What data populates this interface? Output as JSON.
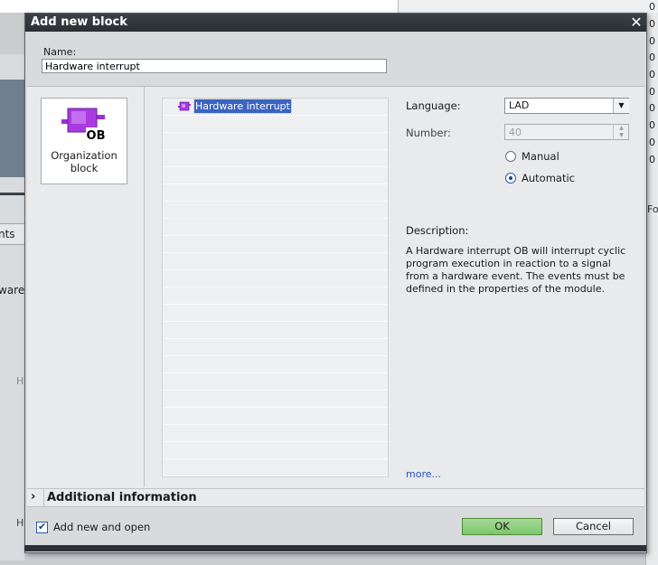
{
  "background_app": {
    "left_tab_label": "nts",
    "left_text_ware": "ware",
    "left_text_h1": "H",
    "left_text_h2": "H",
    "right_column_values": [
      "0",
      "0",
      "0",
      "0",
      "0",
      "0",
      "0",
      "0",
      "0",
      "0"
    ],
    "right_text_fo": "Fo"
  },
  "dialog": {
    "title": "Add new block",
    "close_glyph": "✕",
    "name_label": "Name:",
    "name_value": "Hardware interrupt",
    "block_type": {
      "icon": "organization-block-icon",
      "badge_text": "OB",
      "label_line1": "Organization",
      "label_line2": "block"
    },
    "tree": {
      "items": [
        {
          "label": "Hardware interrupt",
          "selected": true,
          "icon": "ob-small-icon"
        }
      ]
    },
    "language": {
      "label": "Language:",
      "value": "LAD"
    },
    "number": {
      "label": "Number:",
      "value": "40",
      "disabled": true
    },
    "numbering": {
      "manual_label": "Manual",
      "automatic_label": "Automatic",
      "selected": "Automatic"
    },
    "description": {
      "label": "Description:",
      "text": "A Hardware interrupt OB will interrupt cyclic program execution in reaction to a signal from a hardware event. The events must be defined in the properties of the module."
    },
    "more_link": "more...",
    "additional_info": {
      "chevron": "›",
      "label": "Additional information"
    },
    "add_and_open": {
      "label": "Add new and open",
      "checked": true
    },
    "buttons": {
      "ok": "OK",
      "cancel": "Cancel"
    }
  },
  "colors": {
    "title_bar": "#2b2f34",
    "selection": "#3a64c0",
    "ok_button": "#7cc86a",
    "ob_icon": "#9b2fd6",
    "link": "#2a52c8"
  }
}
